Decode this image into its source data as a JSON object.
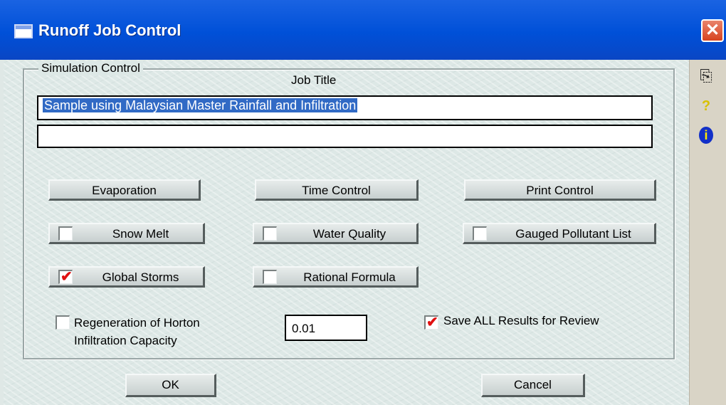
{
  "window": {
    "title": "Runoff Job Control",
    "close_glyph": "✕"
  },
  "group": {
    "legend": "Simulation Control"
  },
  "job_title": {
    "label": "Job Title",
    "line1": "Sample using Malaysian Master Rainfall and Infiltration",
    "line2": ""
  },
  "buttons": {
    "evaporation": "Evaporation",
    "time_control": "Time Control",
    "print_control": "Print Control",
    "snow_melt": "Snow Melt",
    "water_quality": "Water Quality",
    "gauged_pollutant_list": "Gauged Pollutant List",
    "global_storms": "Global Storms",
    "rational_formula": "Rational Formula",
    "ok": "OK",
    "cancel": "Cancel"
  },
  "toggles": {
    "snow_melt_checked": false,
    "water_quality_checked": false,
    "gauged_pollutant_list_checked": false,
    "global_storms_checked": true,
    "rational_formula_checked": false,
    "regeneration_checked": false,
    "save_all_checked": true
  },
  "options": {
    "regeneration_line1": "Regeneration of Horton",
    "regeneration_line2": "Infiltration Capacity",
    "regeneration_value": "0.01",
    "save_all_label": "Save ALL Results for Review"
  },
  "side_tools": {
    "copy_icon": "copy-icon",
    "help_glyph": "?",
    "info_glyph": "i"
  },
  "colors": {
    "title_bar": "#0050d8",
    "selection": "#316ac5",
    "checkmark": "#e01010",
    "close_button": "#d7431f"
  }
}
